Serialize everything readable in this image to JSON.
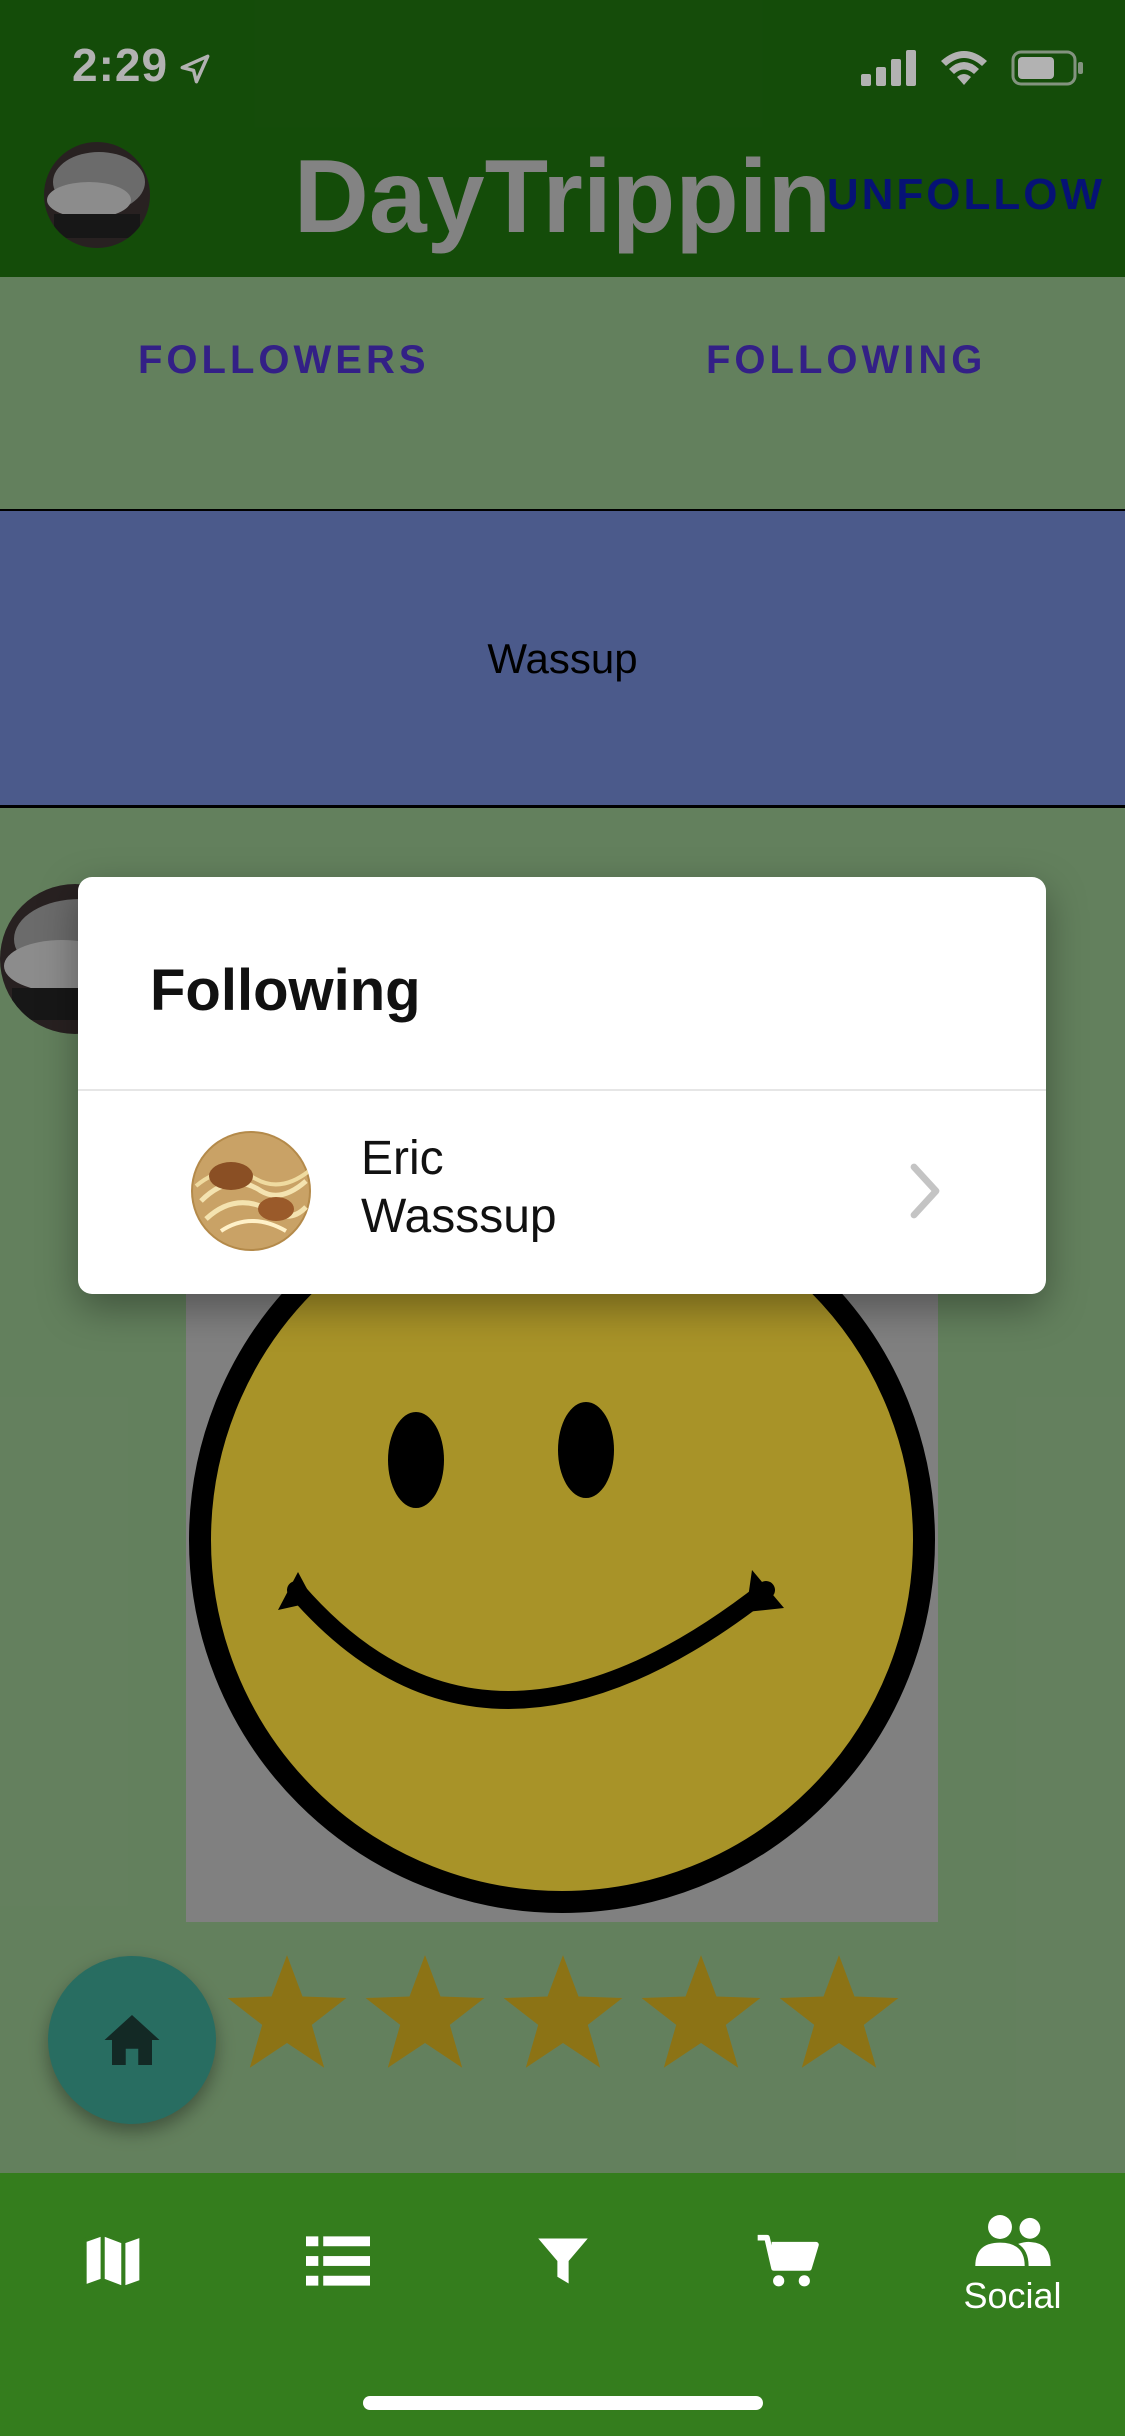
{
  "status_bar": {
    "time": "2:29"
  },
  "header": {
    "title": "DayTrippin",
    "unfollow_label": "UNFOLLOW"
  },
  "tabs": [
    {
      "label": "FOLLOWERS"
    },
    {
      "label": "FOLLOWING"
    }
  ],
  "banner": {
    "text": "Wassup"
  },
  "post": {
    "rating": 5,
    "rating_max": 5
  },
  "dialog": {
    "title": "Following",
    "items": [
      {
        "name": "Eric",
        "subtitle": "Wasssup"
      }
    ]
  },
  "bottom_nav": {
    "items": [
      {
        "icon": "map-icon",
        "label": ""
      },
      {
        "icon": "list-icon",
        "label": ""
      },
      {
        "icon": "filter-icon",
        "label": ""
      },
      {
        "icon": "cart-icon",
        "label": ""
      },
      {
        "icon": "people-icon",
        "label": "Social"
      }
    ]
  },
  "colors": {
    "header_bg": "#1e6d0e",
    "content_bg": "#8fb886",
    "banner_bg": "#6c82c8",
    "nav_bg": "#347d1d",
    "tab_text": "#4a2fc0",
    "unfollow_text": "#0a1aa8",
    "fab_bg": "#3a9c8c",
    "star": "#c9a51f"
  }
}
